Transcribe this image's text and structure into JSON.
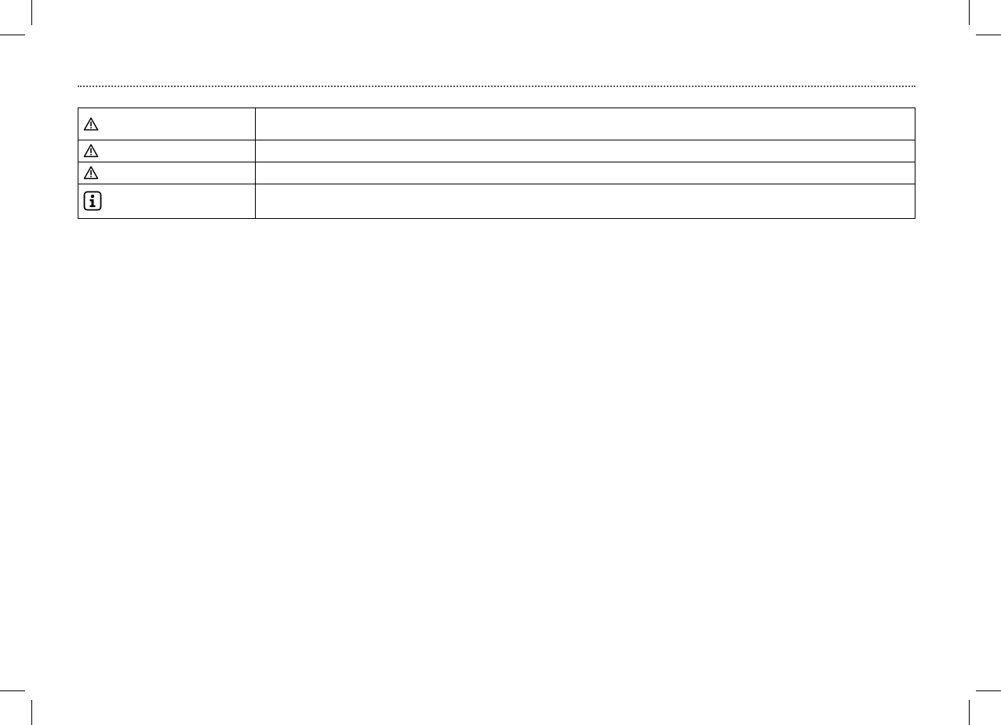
{
  "colors": {
    "ink": "#000000",
    "rule": "#555555",
    "background": "#ffffff"
  },
  "symbols_table": {
    "rows": [
      {
        "icon": "warning-triangle-icon",
        "description": ""
      },
      {
        "icon": "warning-triangle-icon",
        "description": ""
      },
      {
        "icon": "warning-triangle-icon",
        "description": ""
      },
      {
        "icon": "information-icon",
        "description": ""
      }
    ]
  }
}
